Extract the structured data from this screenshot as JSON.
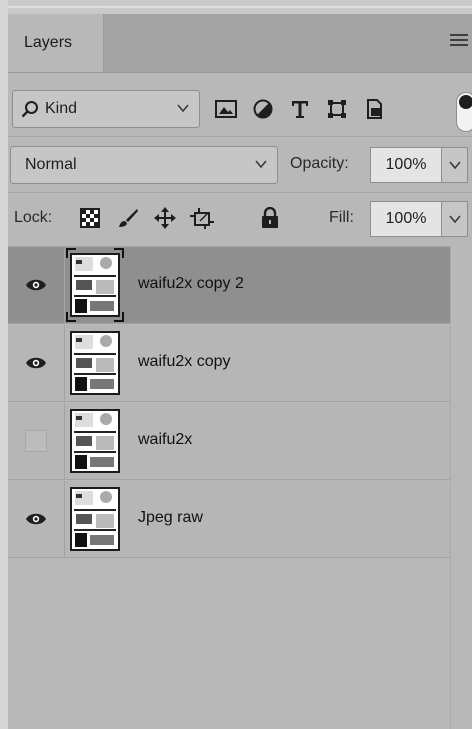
{
  "panel": {
    "tab_label": "Layers",
    "menu_icon": "hamburger-icon"
  },
  "filter_bar": {
    "kind_label": "Kind",
    "icons": [
      "image-filter-icon",
      "adjustment-filter-icon",
      "type-filter-icon",
      "shape-filter-icon",
      "smart-object-filter-icon"
    ],
    "toggle_state": "on"
  },
  "blend_bar": {
    "mode": "Normal",
    "opacity_label": "Opacity:",
    "opacity_value": "100%"
  },
  "lock_bar": {
    "lock_label": "Lock:",
    "lock_icons": [
      "lock-transparent-pixels-icon",
      "lock-image-pixels-icon",
      "lock-position-icon",
      "prevent-auto-nesting-icon",
      "lock-all-icon"
    ],
    "fill_label": "Fill:",
    "fill_value": "100%"
  },
  "layers": [
    {
      "name": "waifu2x copy 2",
      "visible": true,
      "selected": true
    },
    {
      "name": "waifu2x copy",
      "visible": true,
      "selected": false
    },
    {
      "name": "waifu2x",
      "visible": false,
      "selected": false
    },
    {
      "name": "Jpeg raw",
      "visible": true,
      "selected": false
    }
  ],
  "colors": {
    "panel_bg": "#b8b8b8",
    "selected_row": "#8f8f8f",
    "tab_bar": "#a3a3a3"
  }
}
